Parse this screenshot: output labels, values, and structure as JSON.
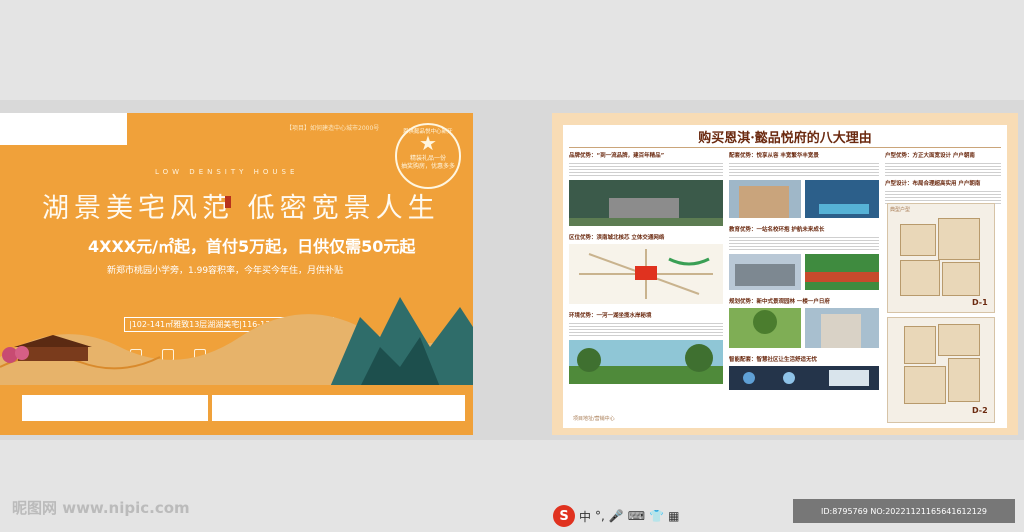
{
  "left_flyer": {
    "top_note": "【项目】如何建造中心城市2000号",
    "seal_ring": "恩淇懿品悦中心新开盘",
    "seal_lines": [
      "精装礼品一份",
      "抽奖购房，优惠多多"
    ],
    "low_density": "LOW DENSITY HOUSE",
    "headline": "湖景美宅风范 低密宽景人生",
    "price": "4XXX元/㎡起，首付5万起，日供仅需50元起",
    "subline": "新郑市桃园小学旁，1.99容积率，今年买今年住，月供补贴",
    "units": "|102-141㎡雅致13层湖湖美宅|116-137㎡宽景8层洋房",
    "colors": {
      "bg": "#f0a13a",
      "text": "#fffaf0",
      "mountain": "#2f6d6a"
    }
  },
  "right_flyer": {
    "title": "购买恩淇·懿品悦府的八大理由",
    "columns": [
      {
        "sections": [
          {
            "title": "品牌优势：“到一流品牌，建百年精品”"
          },
          {
            "title": "区位优势：滨南城北核芯 立体交通网络"
          },
          {
            "title": "环境优势：一河一湖坐揽水岸秘境"
          }
        ]
      },
      {
        "sections": [
          {
            "title": "配套优势：悦享从容 丰宽繁华丰宽景"
          },
          {
            "title": "教育优势：一站名校环抱 护航未来成长"
          },
          {
            "title": "规划优势：新中式景观园林 一楼一户日府"
          },
          {
            "title": "智能配套：智慧社区让生活舒适无忧"
          }
        ]
      },
      {
        "sections": [
          {
            "title": "户型优势：方正大面宽设计 户户朝南"
          },
          {
            "title": "户型设计：布局合理超高实用 户户朝南"
          }
        ]
      }
    ],
    "plan_label": "典型户型",
    "plan_marks": [
      "D-1",
      "D-2"
    ],
    "footer": "项目地址/营销中心"
  },
  "watermark": "昵图网 www.nipic.com",
  "ime": {
    "logo": "S",
    "label": "中",
    "punct": "°,"
  },
  "id_strip": "ID:8795769 NO:20221121165641612129"
}
